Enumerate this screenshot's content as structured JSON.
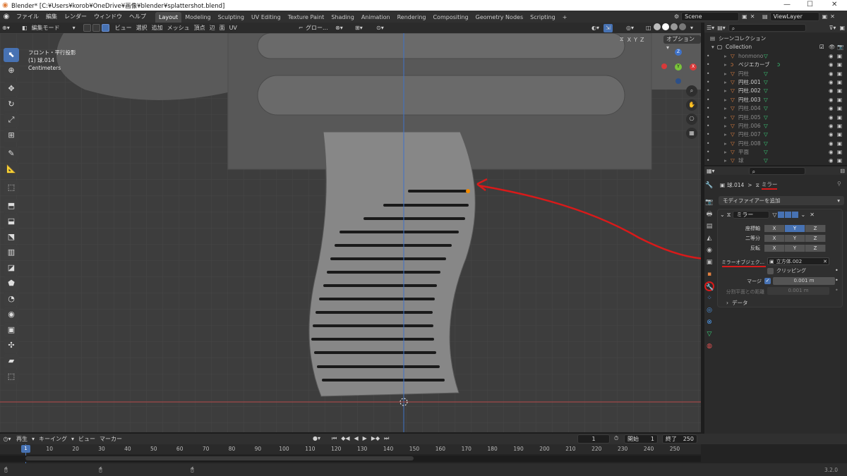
{
  "window": {
    "title": "Blender* [C:¥Users¥korob¥OneDrive¥画像¥blender¥splattershot.blend]",
    "controls": [
      "—",
      "☐",
      "✕"
    ]
  },
  "menu": {
    "items": [
      "ファイル",
      "編集",
      "レンダー",
      "ウィンドウ",
      "ヘルプ"
    ],
    "workspaces": [
      "Layout",
      "Modeling",
      "Sculpting",
      "UV Editing",
      "Texture Paint",
      "Shading",
      "Animation",
      "Rendering",
      "Compositing",
      "Geometry Nodes",
      "Scripting"
    ],
    "add_workspace": "+",
    "scene": "Scene",
    "view_layer": "ViewLayer"
  },
  "viewport_header": {
    "mode": "編集モード",
    "menus": [
      "ビュー",
      "選択",
      "追加",
      "メッシュ",
      "頂点",
      "辺",
      "面",
      "UV"
    ],
    "transform_orientation": "グロー...",
    "axes": [
      "X",
      "Y",
      "Z"
    ],
    "options": "オプション"
  },
  "viewport_overlay": {
    "view_name": "フロント・平行投影",
    "object_name": "(1) 球.014",
    "units": "Centimeters"
  },
  "gizmo": {
    "z": "Z",
    "y": "Y",
    "x": "X"
  },
  "outliner": {
    "collection_title": "シーンコレクション",
    "collection": "Collection",
    "items": [
      {
        "name": "honmono",
        "dim": true
      },
      {
        "name": "ベジエカーブ",
        "dim": false
      },
      {
        "name": "円柱",
        "dim": true
      },
      {
        "name": "円柱.001",
        "dim": false
      },
      {
        "name": "円柱.002",
        "dim": false
      },
      {
        "name": "円柱.003",
        "dim": false
      },
      {
        "name": "円柱.004",
        "dim": true
      },
      {
        "name": "円柱.005",
        "dim": true
      },
      {
        "name": "円柱.006",
        "dim": true
      },
      {
        "name": "円柱.007",
        "dim": true
      },
      {
        "name": "円柱.008",
        "dim": true
      },
      {
        "name": "平面",
        "dim": true
      },
      {
        "name": "球",
        "dim": true
      }
    ]
  },
  "properties": {
    "breadcrumb_object": "球.014",
    "breadcrumb_sep": ">",
    "breadcrumb_modifier": "ミラー",
    "add_modifier": "モディファイアーを追加",
    "modifier_name": "ミラー",
    "rows": {
      "axis_label": "座標軸",
      "bisect_label": "二等分",
      "flip_label": "反転"
    },
    "axes": [
      "X",
      "Y",
      "Z"
    ],
    "mirror_object_label": "ミラーオブジェク...",
    "mirror_object_value": "立方体.002",
    "clipping_label": "クリッピング",
    "merge_label": "マージ",
    "merge_value": "0.001 m",
    "bisect_distance_label": "分割平面との距離",
    "bisect_distance_value": "0.001 m",
    "data_section": "データ"
  },
  "timeline": {
    "menus": [
      "再生",
      "キーイング",
      "ビュー",
      "マーカー"
    ],
    "current_frame": "1",
    "start_label": "開始",
    "start_value": "1",
    "end_label": "終了",
    "end_value": "250",
    "ticks": [
      "1",
      "10",
      "20",
      "30",
      "40",
      "50",
      "60",
      "70",
      "80",
      "90",
      "100",
      "110",
      "120",
      "130",
      "140",
      "150",
      "160",
      "170",
      "180",
      "190",
      "200",
      "210",
      "220",
      "230",
      "240",
      "250"
    ]
  },
  "status": {
    "version": "3.2.0"
  },
  "colors": {
    "accent": "#4772b3",
    "annotation": "#d81a1a",
    "orange": "#e08040",
    "green": "#3ad07a"
  }
}
